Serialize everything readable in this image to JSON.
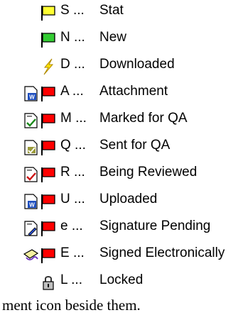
{
  "legend": {
    "items": [
      {
        "code": "S ...",
        "label": "Stat",
        "flag_color": "#ffff33",
        "doc_icon": ""
      },
      {
        "code": "N ...",
        "label": "New",
        "flag_color": "#33cc33",
        "doc_icon": ""
      },
      {
        "code": "D ...",
        "label": "Downloaded",
        "flag_color": "",
        "doc_icon": "lightning-icon"
      },
      {
        "code": "A ...",
        "label": "Attachment",
        "flag_color": "#ff0000",
        "doc_icon": "word-document-icon"
      },
      {
        "code": "M ...",
        "label": "Marked for QA",
        "flag_color": "#ff0000",
        "doc_icon": "marked-document-icon"
      },
      {
        "code": "Q ...",
        "label": "Sent for QA",
        "flag_color": "#ff0000",
        "doc_icon": "qa-document-icon"
      },
      {
        "code": "R ...",
        "label": "Being Reviewed",
        "flag_color": "#ff0000",
        "doc_icon": "review-document-icon"
      },
      {
        "code": "U ...",
        "label": "Uploaded",
        "flag_color": "#ff0000",
        "doc_icon": "word-document-icon"
      },
      {
        "code": "e ...",
        "label": "Signature Pending",
        "flag_color": "#ff0000",
        "doc_icon": "pending-document-icon"
      },
      {
        "code": "E ...",
        "label": "Signed Electronically",
        "flag_color": "#ff0000",
        "doc_icon": "signature-pen-icon"
      },
      {
        "code": "L ...",
        "label": "Locked",
        "flag_color": "",
        "doc_icon": "lock-icon"
      }
    ]
  },
  "caption": "ment icon beside them."
}
